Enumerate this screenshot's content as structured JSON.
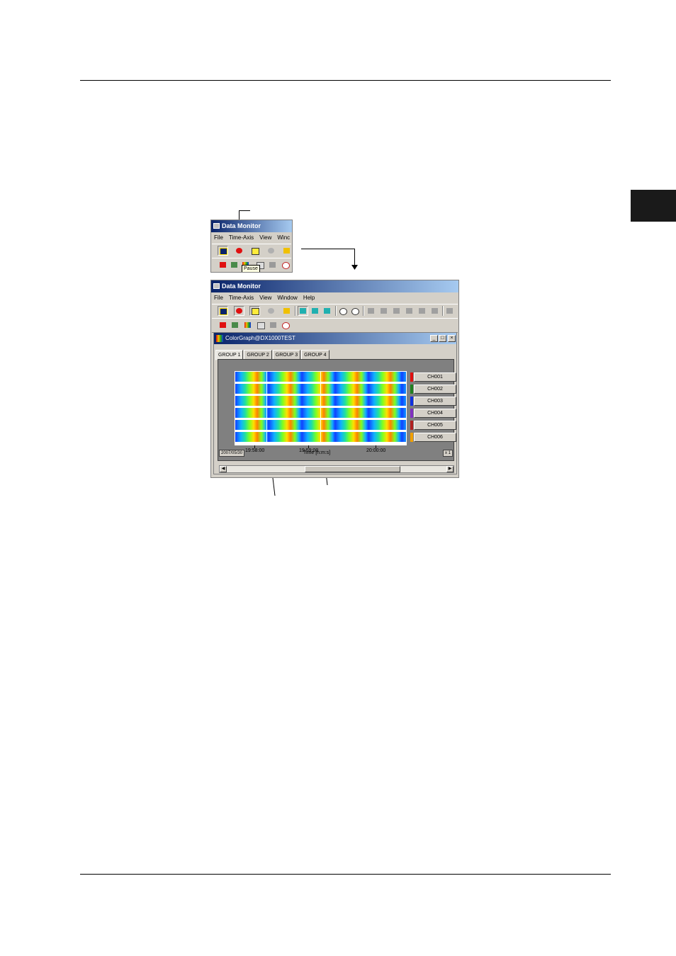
{
  "small_window": {
    "title": "Data Monitor",
    "menu": [
      "File",
      "Time-Axis",
      "View",
      "Winc"
    ],
    "tooltip": "Pause"
  },
  "main_window": {
    "title": "Data Monitor",
    "menu": [
      "File",
      "Time-Axis",
      "View",
      "Window",
      "Help"
    ]
  },
  "child_window": {
    "title": "ColorGraph@DX1000TEST",
    "buttons": [
      "_",
      "□",
      "×"
    ],
    "tabs": [
      "GROUP 1",
      "GROUP 2",
      "GROUP 3",
      "GROUP 4"
    ],
    "active_tab": "GROUP 1",
    "date": "2007/05/30",
    "zoom": "x 1"
  },
  "chart_data": {
    "type": "heatmap",
    "channels": [
      "CH001",
      "CH002",
      "CH003",
      "CH004",
      "CH005",
      "CH006"
    ],
    "channel_colors": [
      "#e01010",
      "#208020",
      "#1030e0",
      "#8030c0",
      "#b02020",
      "#f0a000"
    ],
    "x_ticks": [
      "19:58:00",
      "19:59:00",
      "20:00:00"
    ],
    "xlabel": "Time [h:m:s]",
    "cursor_count": 2
  },
  "colors": {
    "title_start": "#0a246a",
    "title_end": "#a6caf0",
    "face": "#d4d0c8"
  }
}
